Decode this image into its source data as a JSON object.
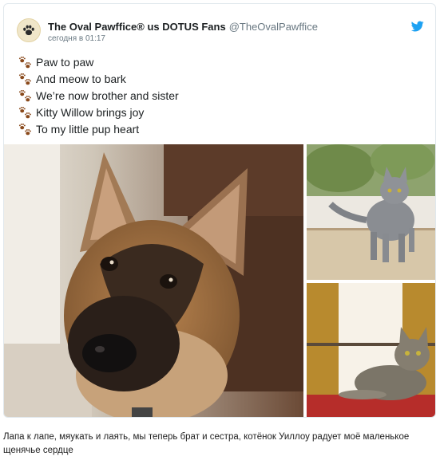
{
  "tweet": {
    "author": {
      "display_name": "The Oval Pawffice® us DOTUS Fans",
      "handle": "@TheOvalPawffice",
      "avatar_icon": "paw-icon"
    },
    "timestamp": "сегодня в 01:17",
    "brand_icon": "twitter-bird-icon",
    "brand_color": "#1da1f2",
    "line_emoji": "paw-prints-emoji",
    "lines": [
      "Paw to paw",
      "And meow to bark",
      "We’re now brother and sister",
      "Kitty Willow brings joy",
      "To my little pup heart"
    ],
    "media": [
      "german-shepherd-puppy-photo",
      "gray-cat-walking-photo",
      "gray-cat-lying-photo"
    ]
  },
  "caption": "Лапа к лапе, мяукать и лаять, мы теперь брат и сестра, котёнок Уиллоу радует моё маленькое щенячье сердце"
}
